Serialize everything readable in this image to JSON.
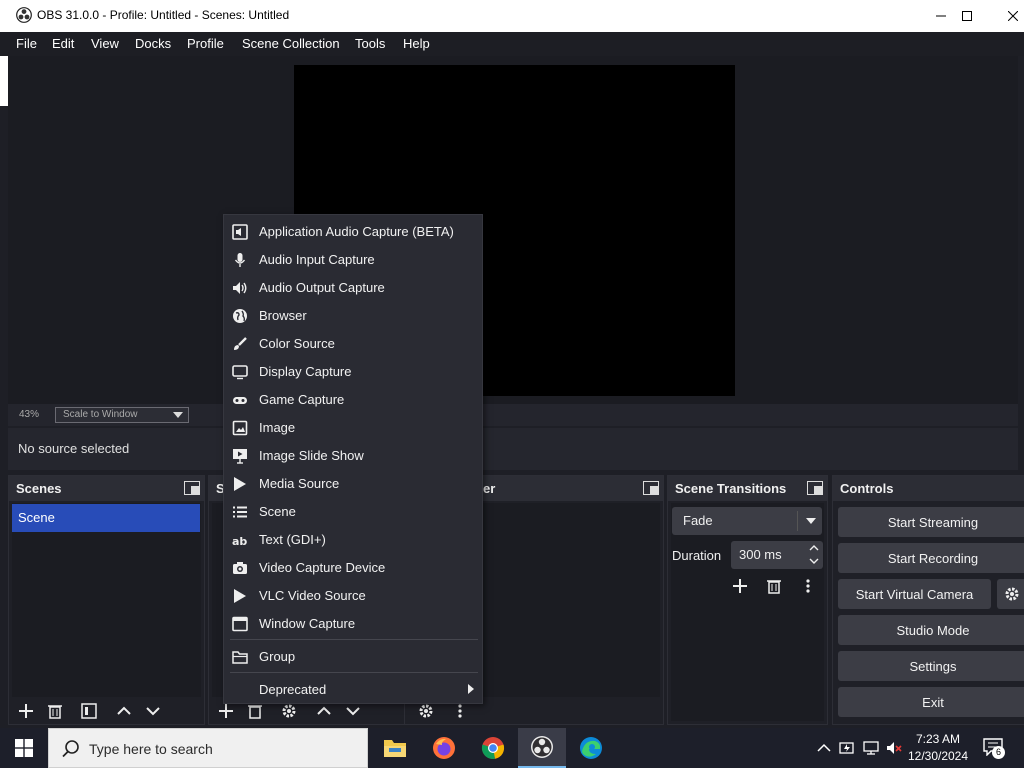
{
  "window": {
    "title": "OBS 31.0.0 - Profile: Untitled - Scenes: Untitled"
  },
  "menubar": {
    "items": [
      "File",
      "Edit",
      "View",
      "Docks",
      "Profile",
      "Scene Collection",
      "Tools",
      "Help"
    ]
  },
  "preview": {
    "zoom": "43%",
    "scale_mode": "Scale to Window",
    "source_status": "No source selected"
  },
  "scenes_dock": {
    "title": "Scenes",
    "items": [
      "Scene"
    ],
    "selected": "Scene"
  },
  "sources_dock": {
    "title_fragment": "S"
  },
  "mixer_dock": {
    "title_fragment": "er"
  },
  "transitions_dock": {
    "title": "Scene Transitions",
    "transition": "Fade",
    "duration_label": "Duration",
    "duration_value": "300 ms"
  },
  "controls_dock": {
    "title": "Controls",
    "buttons": [
      "Start Streaming",
      "Start Recording",
      "Start Virtual Camera",
      "Studio Mode",
      "Settings",
      "Exit"
    ]
  },
  "context_menu": {
    "items": [
      {
        "label": "Application Audio Capture (BETA)",
        "icon": "app-audio-icon"
      },
      {
        "label": "Audio Input Capture",
        "icon": "microphone-icon"
      },
      {
        "label": "Audio Output Capture",
        "icon": "speaker-icon"
      },
      {
        "label": "Browser",
        "icon": "globe-icon"
      },
      {
        "label": "Color Source",
        "icon": "brush-icon"
      },
      {
        "label": "Display Capture",
        "icon": "monitor-icon"
      },
      {
        "label": "Game Capture",
        "icon": "gamepad-icon"
      },
      {
        "label": "Image",
        "icon": "image-icon"
      },
      {
        "label": "Image Slide Show",
        "icon": "slideshow-icon"
      },
      {
        "label": "Media Source",
        "icon": "play-icon"
      },
      {
        "label": "Scene",
        "icon": "list-icon"
      },
      {
        "label": "Text (GDI+)",
        "icon": "text-icon"
      },
      {
        "label": "Video Capture Device",
        "icon": "camera-icon"
      },
      {
        "label": "VLC Video Source",
        "icon": "play-icon"
      },
      {
        "label": "Window Capture",
        "icon": "window-icon"
      }
    ],
    "group": {
      "label": "Group",
      "icon": "folder-icon"
    },
    "deprecated": {
      "label": "Deprecated"
    }
  },
  "taskbar": {
    "search_placeholder": "Type here to search",
    "apps": [
      "file-explorer-icon",
      "firefox-icon",
      "chrome-icon",
      "obs-icon",
      "edge-icon"
    ],
    "time": "7:23 AM",
    "date": "12/30/2024",
    "notification_count": "6"
  }
}
